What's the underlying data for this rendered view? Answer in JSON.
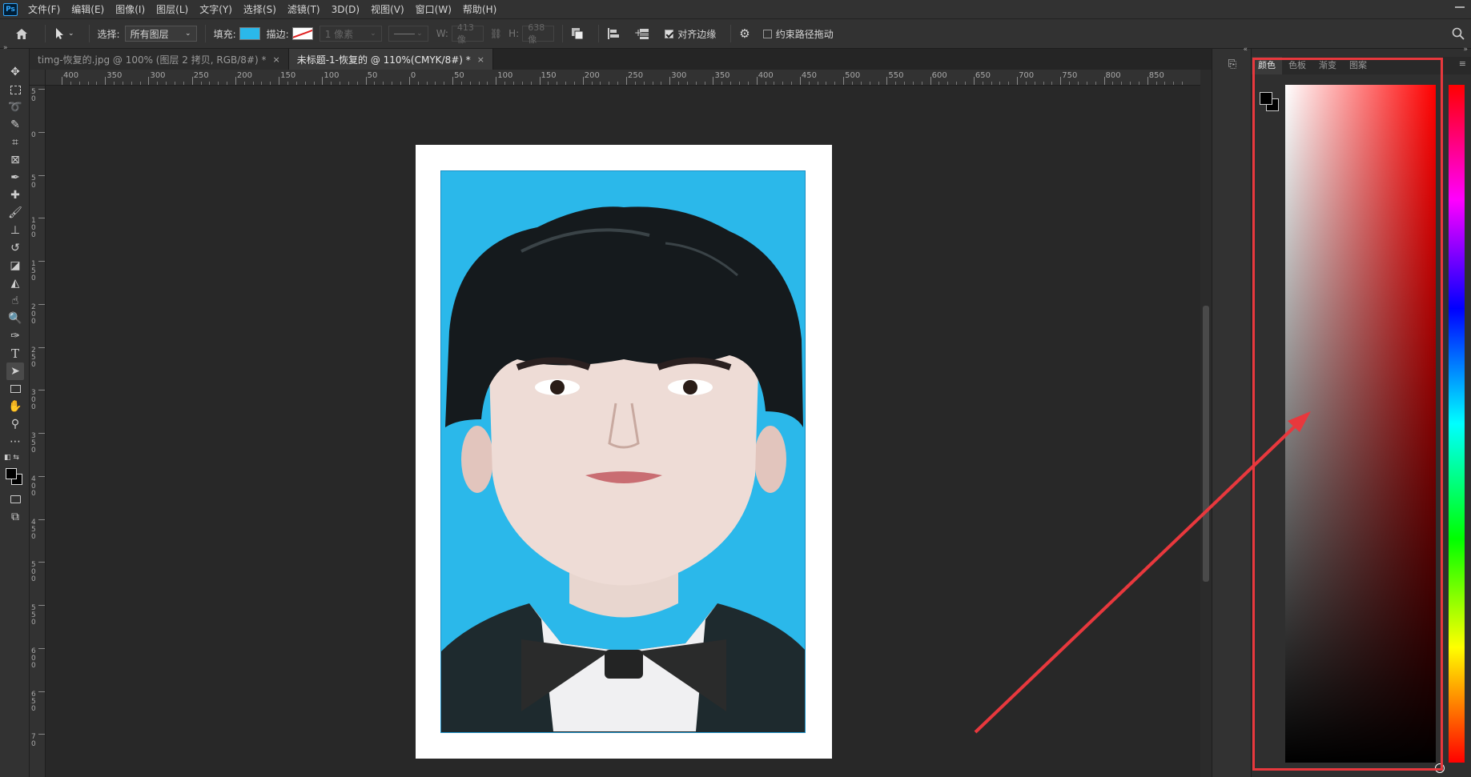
{
  "app": {
    "logo": "Ps"
  },
  "menu": [
    "文件(F)",
    "编辑(E)",
    "图像(I)",
    "图层(L)",
    "文字(Y)",
    "选择(S)",
    "滤镜(T)",
    "3D(D)",
    "视图(V)",
    "窗口(W)",
    "帮助(H)"
  ],
  "options": {
    "select_label": "选择:",
    "select_value": "所有图层",
    "fill_label": "填充:",
    "fill_color": "#2bb8ea",
    "stroke_label": "描边:",
    "stroke_width": "1 像素",
    "w_label": "W:",
    "w_value": "413 像",
    "h_label": "H:",
    "h_value": "638 像",
    "align_edges_label": "对齐边缘",
    "constrain_path_label": "约束路径拖动"
  },
  "tabs": [
    {
      "label": "timg-恢复的.jpg @ 100% (图层 2 拷贝, RGB/8#) *",
      "active": false
    },
    {
      "label": "未标题-1-恢复的 @ 110%(CMYK/8#) *",
      "active": true
    }
  ],
  "ruler_h": [
    "400",
    "350",
    "300",
    "250",
    "200",
    "150",
    "100",
    "50",
    "0",
    "50",
    "100",
    "150",
    "200",
    "250",
    "300",
    "350",
    "400",
    "450",
    "500",
    "550",
    "600",
    "650",
    "700",
    "750",
    "800",
    "850"
  ],
  "ruler_v": [
    "5\n0",
    "0",
    "5\n0",
    "1\n0\n0",
    "1\n5\n0",
    "2\n0\n0",
    "2\n5\n0",
    "3\n0\n0",
    "3\n5\n0",
    "4\n0\n0",
    "4\n5\n0",
    "5\n0\n0",
    "5\n5\n0",
    "6\n0\n0",
    "6\n5\n0",
    "7\n0"
  ],
  "color_panel": {
    "tabs": [
      "颜色",
      "色板",
      "渐变",
      "图案"
    ],
    "active_tab": "颜色",
    "hue_color": "#ff0000",
    "foreground": "#000000",
    "background": "#ffffff"
  },
  "annotation": {
    "color": "#e8383d"
  }
}
